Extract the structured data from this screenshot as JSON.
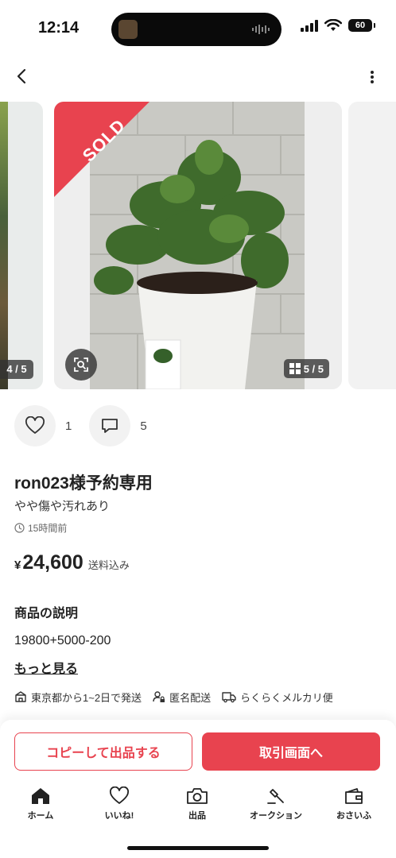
{
  "status": {
    "time": "12:14",
    "battery": "60"
  },
  "carousel": {
    "prev_counter": "4 / 5",
    "counter": "5 / 5",
    "sold_badge": "SOLD"
  },
  "actions": {
    "like_count": "1",
    "comment_count": "5"
  },
  "item": {
    "title": "ron023様予約専用",
    "condition": "やや傷や汚れあり",
    "posted": "15時間前",
    "currency": "¥",
    "price": "24,600",
    "shipping_note": "送料込み"
  },
  "description": {
    "heading": "商品の説明",
    "body": "19800+5000-200",
    "more": "もっと見る"
  },
  "tags": [
    {
      "label": "東京都から1~2日で発送",
      "icon": "box-icon"
    },
    {
      "label": "匿名配送",
      "icon": "person-lock-icon"
    },
    {
      "label": "らくらくメルカリ便",
      "icon": "truck-icon"
    }
  ],
  "buttons": {
    "copy": "コピーして出品する",
    "deal": "取引画面へ"
  },
  "tabbar": [
    {
      "label": "ホーム",
      "icon": "home-icon"
    },
    {
      "label": "いいね!",
      "icon": "heart-icon"
    },
    {
      "label": "出品",
      "icon": "camera-icon"
    },
    {
      "label": "オークション",
      "icon": "gavel-icon"
    },
    {
      "label": "おさいふ",
      "icon": "wallet-icon"
    }
  ],
  "colors": {
    "accent": "#e8434f",
    "text": "#222222"
  }
}
